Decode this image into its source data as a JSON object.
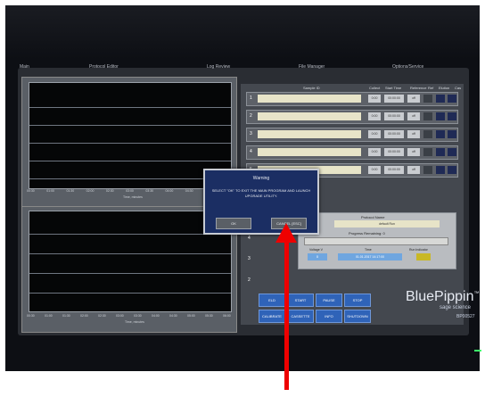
{
  "tabs": [
    "Main",
    "Protocol Editor",
    "Log Review",
    "File Manager",
    "Options/Service"
  ],
  "top_plot": {
    "x_ticks": [
      "00:30",
      "01:00",
      "01:30",
      "02:00",
      "02:30",
      "03:00",
      "03:30",
      "04:00",
      "04:30",
      "05:00"
    ],
    "x_label": "Time, minutes"
  },
  "bottom_plot": {
    "x_ticks": [
      "00:30",
      "01:00",
      "01:30",
      "02:00",
      "02:30",
      "03:00",
      "03:30",
      "04:00",
      "04:30",
      "05:00",
      "05:30",
      "06:00"
    ],
    "x_label": "Time, minutes"
  },
  "lanes_header": {
    "sample_id": "Sample ID",
    "collect": "Collect",
    "start": "Start Time",
    "reference": "Reference",
    "ref_flag": "Ref",
    "elution": "Elution",
    "cas": "Cas"
  },
  "lanes": [
    {
      "num": "1",
      "a": "0:00",
      "b": "00:00:00",
      "c": "off"
    },
    {
      "num": "2",
      "a": "0:00",
      "b": "00:00:00",
      "c": "off"
    },
    {
      "num": "3",
      "a": "0:00",
      "b": "00:00:00",
      "c": "off"
    },
    {
      "num": "4",
      "a": "0:00",
      "b": "00:00:00",
      "c": "off"
    },
    {
      "num": "5",
      "a": "0:00",
      "b": "00:00:00",
      "c": "off"
    }
  ],
  "run": {
    "protocol_label": "Protocol Name",
    "protocol_value": "default Run",
    "progress_label": "Progress Remaining: 0",
    "voltage_label": "Voltage V",
    "voltage_value": "0",
    "time_label": "Time",
    "time_value": "01.01.2017  14:17:00",
    "status_label": "Run Indicator"
  },
  "buttons": [
    "ELD",
    "START",
    "PAUSE",
    "STOP",
    "CALIBRATE",
    "CASSETTE",
    "INFO",
    "SHUTDOWN"
  ],
  "dialog": {
    "title": "Warning",
    "message": "SELECT \"OK\" TO EXIT THE MAIN PROGRAM AND LAUNCH UPGRADE UTILITY.",
    "ok": "OK",
    "cancel": "CANCEL [ESC]"
  },
  "brand": {
    "name": "BluePippin",
    "tm": "™",
    "sub": "sage science",
    "model": "BP00527"
  },
  "colors": {
    "annotation_arrow": "#ee0000",
    "dialog_bg": "#1b2e63",
    "button_blue": "#2f63b8",
    "sample_field": "#e7e4c8"
  }
}
